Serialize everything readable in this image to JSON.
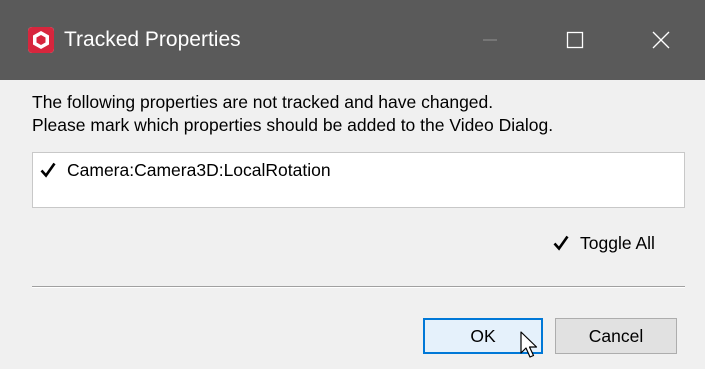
{
  "window": {
    "title": "Tracked Properties",
    "app_icon": "app-logo-icon",
    "controls": [
      "minimize-icon",
      "maximize-icon",
      "close-icon"
    ]
  },
  "message": {
    "line1": "The following properties are not tracked and have changed.",
    "line2": "Please mark which properties should be added to the Video Dialog."
  },
  "properties": [
    {
      "label": "Camera:Camera3D:LocalRotation",
      "checked": true
    }
  ],
  "toggle_all": {
    "label": "Toggle All",
    "checked": true
  },
  "buttons": {
    "ok": "OK",
    "cancel": "Cancel"
  },
  "colors": {
    "titlebar": "#5a5a5a",
    "app_icon_accent": "#d7263d",
    "focus_border": "#0078d7",
    "dialog_bg": "#f0f0f0"
  }
}
